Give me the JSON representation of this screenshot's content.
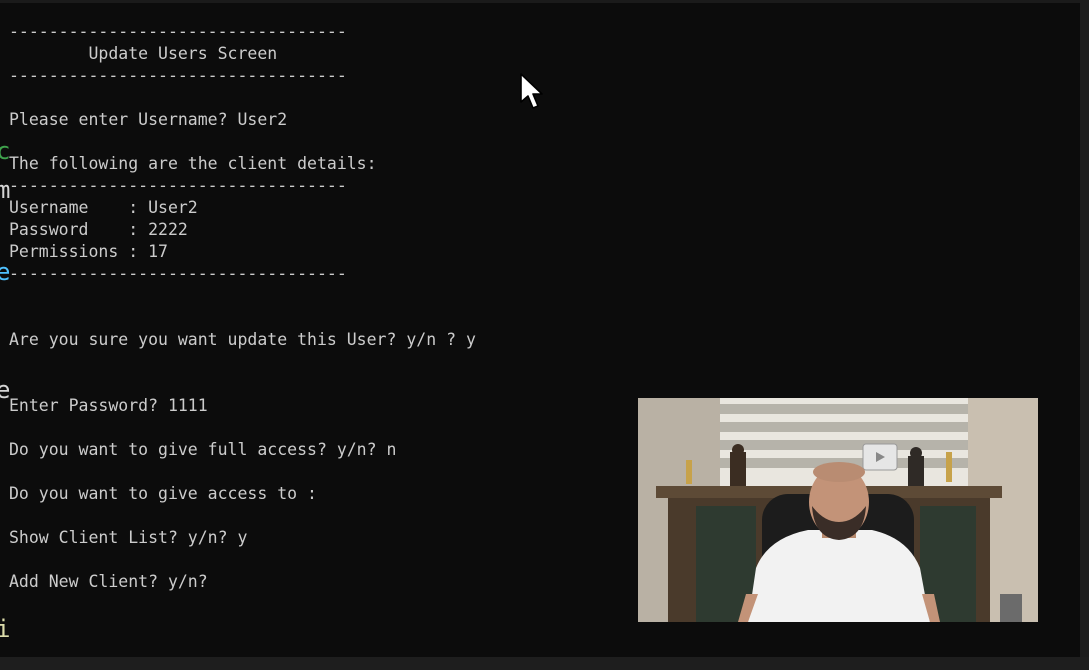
{
  "console": {
    "lines": [
      "----------------------------------",
      "        Update Users Screen",
      "----------------------------------",
      "Please enter Username? User2",
      "The following are the client details:",
      "----------------------------------",
      "Username    : User2",
      "Password    : 2222",
      "Permissions : 17",
      "----------------------------------",
      "Are you sure you want update this User? y/n ? y",
      "Enter Password? 1111",
      "Do you want to give full access? y/n? n",
      "Do you want to give access to :",
      "Show Client List? y/n? y",
      "Add New Client? y/n?"
    ]
  },
  "background_editor": {
    "edge_glyphs": [
      "c",
      "m",
      "e",
      "e",
      "i"
    ],
    "colors": [
      "#3fa34d",
      "#d4d4d4",
      "#4fc1ff",
      "#d4d4d4",
      "#dcdcaa"
    ]
  },
  "overlay": {
    "type": "webcam",
    "description_icon": "presenter-video-icon"
  },
  "colors": {
    "background": "#0c0c0c",
    "text": "#cccccc"
  }
}
